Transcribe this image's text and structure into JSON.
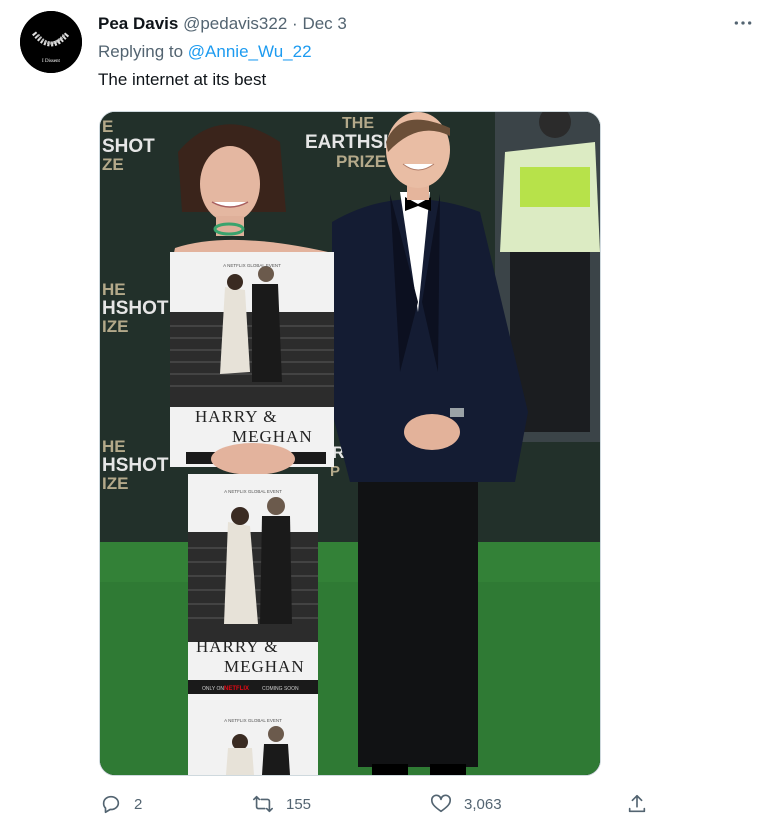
{
  "tweet": {
    "author_name": "Pea Davis",
    "handle": "@pedavis322",
    "separator": "·",
    "date": "Dec 3",
    "reply_prefix": "Replying to",
    "reply_mention": "@Annie_Wu_22",
    "text": "The internet at its best",
    "more_icon": "more-horizontal-icon",
    "avatar_caption": "I Dissent"
  },
  "image": {
    "backdrop_words": [
      "THE",
      "EARTHSHOT",
      "PRIZE"
    ],
    "backdrop_fragments": [
      "E",
      "SHOT",
      "ZE",
      "HE",
      "HSHOT",
      "IZE",
      "HE",
      "HSHOT",
      "IZE",
      "AR",
      "P"
    ],
    "poster_top": "A NETFLIX GLOBAL EVENT",
    "poster_title_1": "HARRY &",
    "poster_title_2": "MEGHAN",
    "poster_footer_left": "ONLY ON",
    "poster_footer_brand": "NETFLIX",
    "poster_footer_right": "COMING SOON",
    "colors": {
      "carpet": "#2f7a34",
      "backdrop": "#1e2b26",
      "netflix_red": "#e50914",
      "jacket": "#141c33"
    }
  },
  "actions": {
    "reply": {
      "icon": "reply-icon",
      "count": "2"
    },
    "retweet": {
      "icon": "retweet-icon",
      "count": "155"
    },
    "like": {
      "icon": "heart-icon",
      "count": "3,063"
    },
    "share": {
      "icon": "share-icon"
    }
  }
}
